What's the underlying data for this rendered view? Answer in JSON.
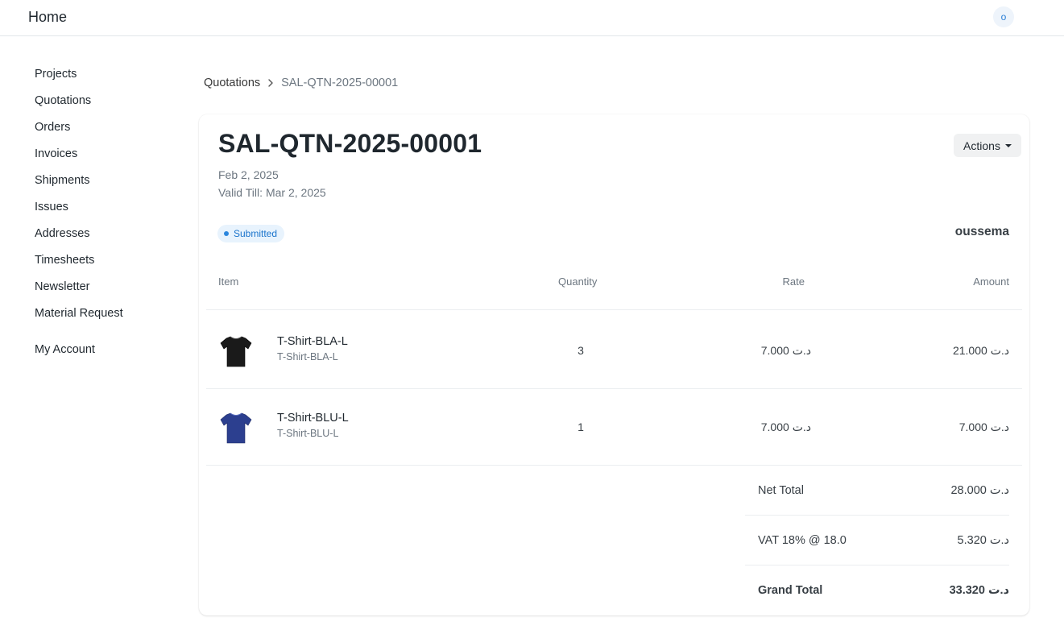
{
  "navbar": {
    "brand": "Home",
    "avatar_initial": "o"
  },
  "sidebar": {
    "items": [
      {
        "label": "Projects"
      },
      {
        "label": "Quotations"
      },
      {
        "label": "Orders"
      },
      {
        "label": "Invoices"
      },
      {
        "label": "Shipments"
      },
      {
        "label": "Issues"
      },
      {
        "label": "Addresses"
      },
      {
        "label": "Timesheets"
      },
      {
        "label": "Newsletter"
      },
      {
        "label": "Material Request"
      },
      {
        "label": "My Account"
      }
    ]
  },
  "breadcrumb": {
    "parent": "Quotations",
    "current": "SAL-QTN-2025-00001"
  },
  "document": {
    "title": "SAL-QTN-2025-00001",
    "date": "Feb 2, 2025",
    "valid_till_label": "Valid Till:",
    "valid_till": "Mar 2, 2025",
    "status": "Submitted",
    "status_color": "#1b74cc",
    "customer": "oussema",
    "actions_label": "Actions"
  },
  "table": {
    "headers": {
      "item": "Item",
      "quantity": "Quantity",
      "rate": "Rate",
      "amount": "Amount"
    },
    "rows": [
      {
        "name": "T-Shirt-BLA-L",
        "code": "T-Shirt-BLA-L",
        "qty": "3",
        "rate": "7.000 د.ت",
        "amount": "21.000 د.ت",
        "icon": "black-tshirt-icon",
        "color": "#1a1a1a"
      },
      {
        "name": "T-Shirt-BLU-L",
        "code": "T-Shirt-BLU-L",
        "qty": "1",
        "rate": "7.000 د.ت",
        "amount": "7.000 د.ت",
        "icon": "blue-tshirt-icon",
        "color": "#2c3f8f"
      }
    ]
  },
  "totals": {
    "net_total_label": "Net Total",
    "net_total": "28.000 د.ت",
    "vat_label": "VAT 18% @ 18.0",
    "vat": "5.320 د.ت",
    "grand_total_label": "Grand Total",
    "grand_total": "33.320 د.ت"
  }
}
